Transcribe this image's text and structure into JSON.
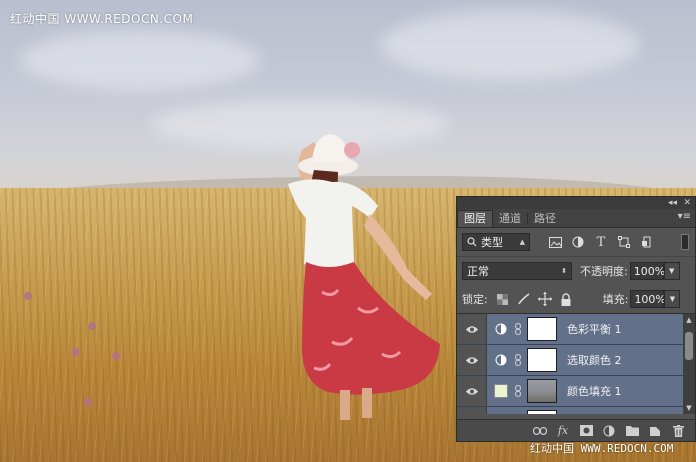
{
  "watermark": {
    "top_left": "红动中国 WWW.REDOCN.COM",
    "bottom": "红动中国 WWW.REDOCN.COM"
  },
  "panel": {
    "tabs": [
      {
        "label": "图层",
        "active": true
      },
      {
        "label": "通道",
        "active": false
      },
      {
        "label": "路径",
        "active": false
      }
    ],
    "filter": {
      "kind_label": "类型",
      "icons": [
        "image-icon",
        "adjustment-icon",
        "text-icon",
        "shape-icon",
        "smart-object-icon"
      ]
    },
    "blend_mode": "正常",
    "opacity_label": "不透明度:",
    "opacity_value": "100%",
    "lock_label": "锁定:",
    "fill_label": "填充:",
    "fill_value": "100%",
    "layers": [
      {
        "name": "色彩平衡 1",
        "type": "adjustment",
        "visible": true
      },
      {
        "name": "选取颜色 2",
        "type": "adjustment",
        "visible": true
      },
      {
        "name": "颜色填充 1",
        "type": "fill",
        "visible": true,
        "swatch_color": "#e8f3cf"
      }
    ],
    "bottom_icons": [
      "link-layers-icon",
      "fx-icon",
      "add-mask-icon",
      "new-adjustment-icon",
      "new-group-icon",
      "new-layer-icon",
      "delete-icon"
    ],
    "colors": {
      "panel_bg": "#535353",
      "selected_layer": "#627089"
    }
  }
}
